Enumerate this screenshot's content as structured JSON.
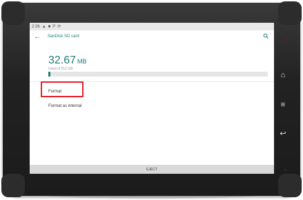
{
  "status_bar": {
    "time": "2:36"
  },
  "app_bar": {
    "title": "SanDisk SD card"
  },
  "storage": {
    "used_number": "32.67",
    "used_unit": "MB",
    "used_subtitle": "Used of 512 GB",
    "usage_fraction": 0.01
  },
  "options": [
    {
      "label": "Format"
    },
    {
      "label": "Format as internal"
    }
  ],
  "eject_label": "EJECT",
  "colors": {
    "accent": "#1e7d76",
    "highlight_box": "#e0202a"
  },
  "icons": [
    "back-arrow-icon",
    "search-icon",
    "home-icon",
    "menu-icon",
    "back-nav-icon"
  ]
}
